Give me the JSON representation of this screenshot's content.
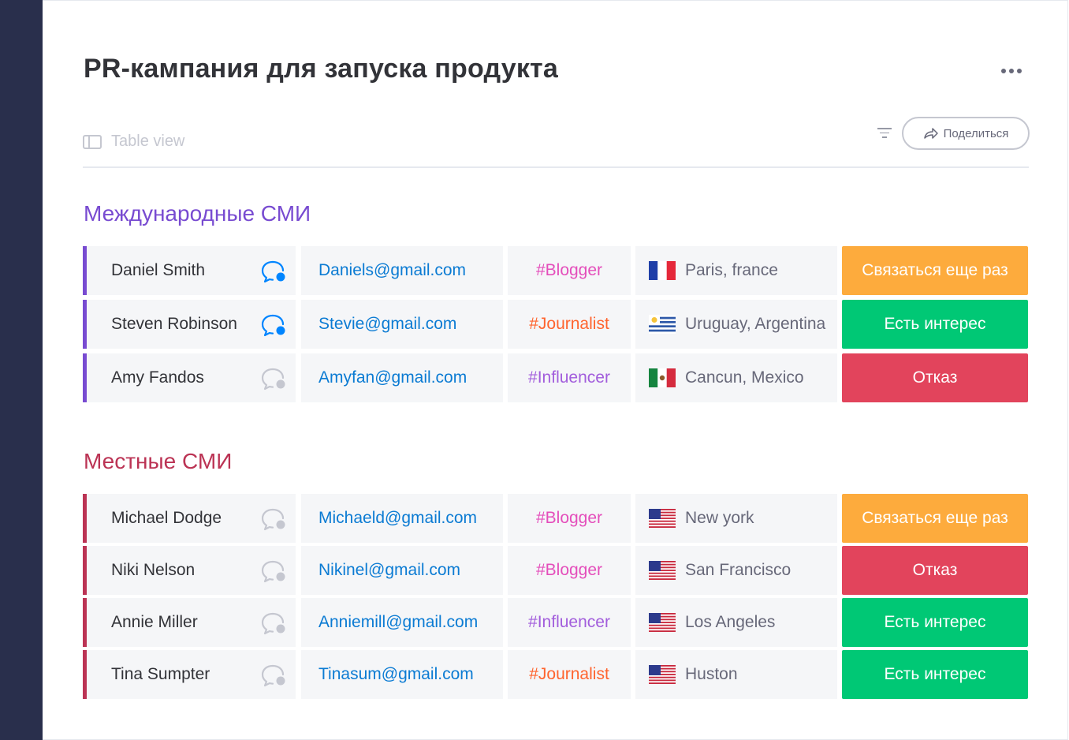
{
  "board": {
    "title": "PR-кампания для запуска продукта",
    "view_label": "Table view",
    "share_label": "Поделиться"
  },
  "colors": {
    "sidebar": "#292f4c",
    "group_international": "#784bd1",
    "group_local": "#bb3354",
    "email": "#0b7bd3",
    "status_orange": "#fdab3d",
    "status_green": "#00c875",
    "status_red": "#e2445c",
    "tag_blogger": "#e44ebb",
    "tag_journalist": "#ff642e",
    "tag_influencer": "#a25ddc"
  },
  "groups": [
    {
      "title": "Международные СМИ",
      "color": "#784bd1",
      "rows": [
        {
          "name": "Daniel Smith",
          "chat_active": true,
          "email": "Daniels@gmail.com",
          "tag": "#Blogger",
          "location": "Paris, france",
          "flag": "france-flag-icon",
          "status": "Связаться еще раз",
          "status_color": "#fdab3d"
        },
        {
          "name": "Steven Robinson",
          "chat_active": true,
          "email": "Stevie@gmail.com",
          "tag": "#Journalist",
          "location": "Uruguay, Argentina",
          "flag": "uruguay-flag-icon",
          "status": "Есть интерес",
          "status_color": "#00c875"
        },
        {
          "name": "Amy Fandos",
          "chat_active": false,
          "email": "Amyfan@gmail.com",
          "tag": "#Influencer",
          "location": "Cancun, Mexico",
          "flag": "mexico-flag-icon",
          "status": "Отказ",
          "status_color": "#e2445c"
        }
      ]
    },
    {
      "title": "Местные СМИ",
      "color": "#bb3354",
      "rows": [
        {
          "name": "Michael Dodge",
          "chat_active": false,
          "email": "Michaeld@gmail.com",
          "tag": "#Blogger",
          "location": "New york",
          "flag": "usa-flag-icon",
          "status": "Связаться еще раз",
          "status_color": "#fdab3d"
        },
        {
          "name": "Niki Nelson",
          "chat_active": false,
          "email": "Nikinel@gmail.com",
          "tag": "#Blogger",
          "location": "San Francisco",
          "flag": "usa-flag-icon",
          "status": "Отказ",
          "status_color": "#e2445c"
        },
        {
          "name": "Annie Miller",
          "chat_active": false,
          "email": "Anniemill@gmail.com",
          "tag": "#Influencer",
          "location": "Los Angeles",
          "flag": "usa-flag-icon",
          "status": "Есть интерес",
          "status_color": "#00c875"
        },
        {
          "name": "Tina Sumpter",
          "chat_active": false,
          "email": "Tinasum@gmail.com",
          "tag": "#Journalist",
          "location": "Huston",
          "flag": "usa-flag-icon",
          "status": "Есть интерес",
          "status_color": "#00c875"
        }
      ]
    }
  ]
}
